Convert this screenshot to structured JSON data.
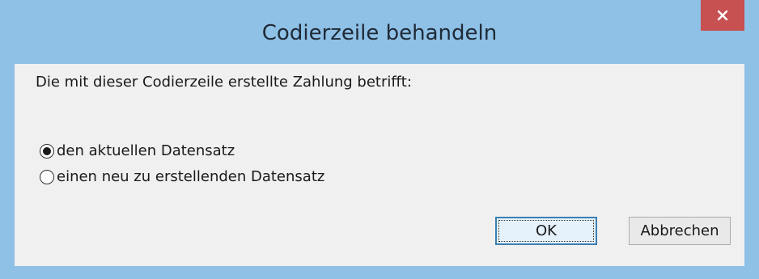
{
  "window": {
    "title": "Codierzeile behandeln"
  },
  "dialog": {
    "prompt": "Die mit dieser Codierzeile erstellte Zahlung betrifft:",
    "options": [
      {
        "label": "den aktuellen Datensatz",
        "selected": true
      },
      {
        "label": "einen neu zu erstellenden Datensatz",
        "selected": false
      }
    ],
    "ok_label": "OK",
    "cancel_label": "Abbrechen"
  },
  "icons": {
    "close": "close-icon",
    "radio_selected": "radio-selected-icon",
    "radio_unselected": "radio-unselected-icon"
  },
  "colors": {
    "titlebar": "#8fc0e6",
    "close_button": "#c75050",
    "dialog_background": "#f0f0f0",
    "default_button_border": "#3c7fb1"
  }
}
